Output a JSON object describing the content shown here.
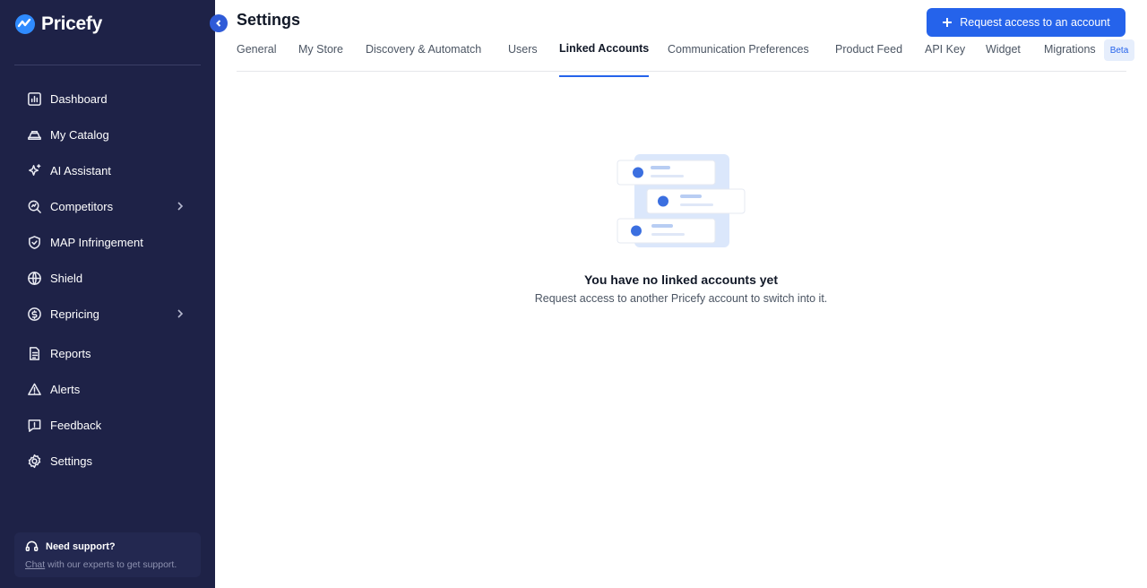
{
  "app": {
    "name": "Pricefy"
  },
  "sidebar": {
    "items": [
      {
        "label": "Dashboard",
        "icon": "dashboard-icon",
        "has_children": false
      },
      {
        "label": "My Catalog",
        "icon": "catalog-icon",
        "has_children": false
      },
      {
        "label": "AI Assistant",
        "icon": "sparkle-icon",
        "has_children": false
      },
      {
        "label": "Competitors",
        "icon": "competitors-icon",
        "has_children": true
      },
      {
        "label": "MAP Infringement",
        "icon": "shield-check-icon",
        "has_children": false
      },
      {
        "label": "Shield",
        "icon": "globe-icon",
        "has_children": false
      },
      {
        "label": "Repricing",
        "icon": "repricing-icon",
        "has_children": true
      },
      {
        "label": "Reports",
        "icon": "document-icon",
        "has_children": false
      },
      {
        "label": "Alerts",
        "icon": "warning-icon",
        "has_children": false
      },
      {
        "label": "Feedback",
        "icon": "feedback-icon",
        "has_children": false
      },
      {
        "label": "Settings",
        "icon": "gear-icon",
        "has_children": false
      }
    ],
    "support": {
      "title": "Need support?",
      "link": "Chat",
      "text": " with our experts to get support."
    }
  },
  "header": {
    "title": "Settings",
    "action_label": "Request access to an account"
  },
  "tabs": [
    {
      "label": "General"
    },
    {
      "label": "My Store"
    },
    {
      "label": "Discovery & Automatch"
    },
    {
      "label": "Users"
    },
    {
      "label": "Linked Accounts",
      "active": true
    },
    {
      "label": "Communication Preferences"
    },
    {
      "label": "Product Feed"
    },
    {
      "label": "API Key"
    },
    {
      "label": "Widget"
    },
    {
      "label": "Migrations"
    }
  ],
  "beta_label": "Beta",
  "empty_state": {
    "title": "You have no linked accounts yet",
    "subtitle": "Request access to another Pricefy account to switch into it."
  },
  "colors": {
    "sidebar_bg": "#1e2247",
    "accent": "#2563eb"
  }
}
